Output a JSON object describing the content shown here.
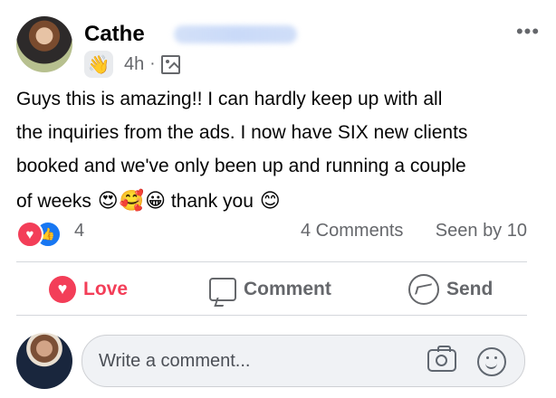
{
  "post": {
    "author_name_visible": "Cathe",
    "time": "4h",
    "separator": "·",
    "body_lines": [
      "Guys this is amazing!! I can hardly keep up with all",
      "the inquiries from the ads. I now have SIX new clients",
      "booked and we've only been up and running a couple",
      "of weeks"
    ],
    "emojis": [
      "😍",
      "🥰",
      "😀"
    ],
    "thanks_text": "thank you",
    "final_emoji": "😊"
  },
  "reactions": {
    "count": "4",
    "comments": "4 Comments",
    "seen": "Seen by 10",
    "love_glyph": "♥",
    "like_glyph": "👍"
  },
  "actions": {
    "love": "Love",
    "comment": "Comment",
    "send": "Send",
    "love_glyph": "♥"
  },
  "composer": {
    "placeholder": "Write a comment..."
  },
  "icons": {
    "more": "•••",
    "wave": "👋"
  },
  "colors": {
    "love": "#f33e58",
    "like": "#1877f2",
    "muted": "#65676b"
  }
}
